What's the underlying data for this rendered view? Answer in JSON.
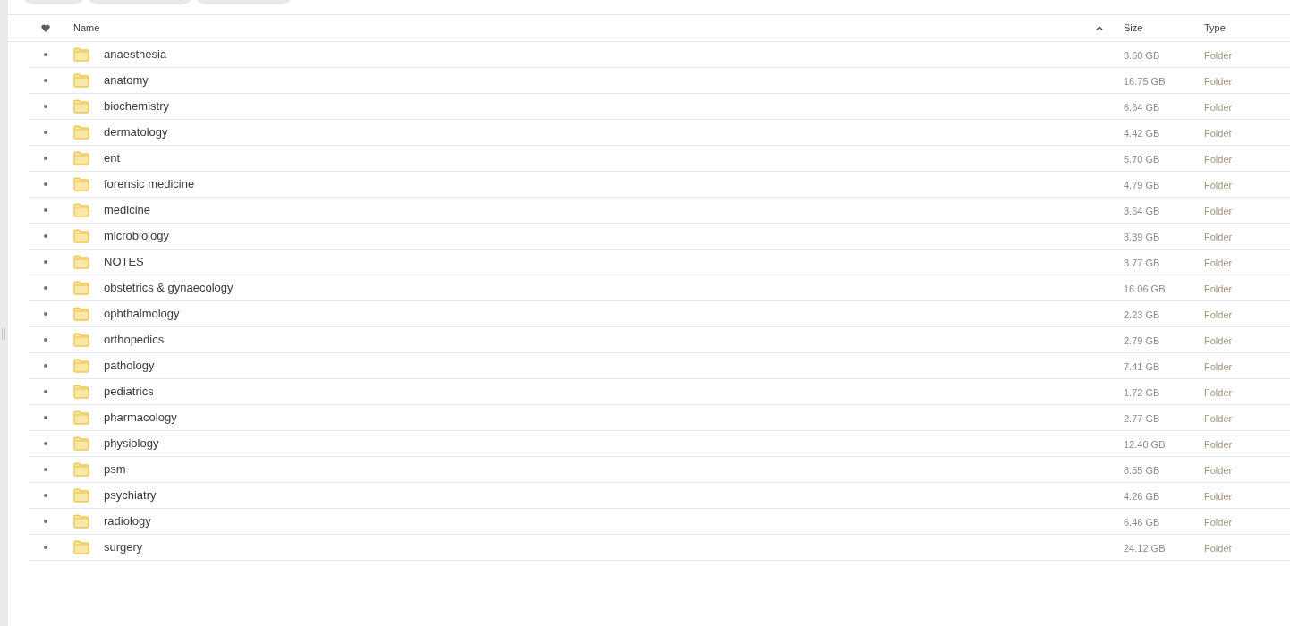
{
  "columns": [
    {
      "kind": "icon"
    },
    {
      "kind": "text",
      "label": "Name",
      "sorted": true
    },
    {
      "kind": "text",
      "label": "Size",
      "sorted": false
    },
    {
      "kind": "text",
      "label": "Type",
      "sorted": false
    }
  ],
  "rows": [
    {
      "name": "anaesthesia",
      "size": "3.60 GB",
      "type": "Folder"
    },
    {
      "name": "anatomy",
      "size": "16.75 GB",
      "type": "Folder"
    },
    {
      "name": "biochemistry",
      "size": "6.64 GB",
      "type": "Folder"
    },
    {
      "name": "dermatology",
      "size": "4.42 GB",
      "type": "Folder"
    },
    {
      "name": "ent",
      "size": "5.70 GB",
      "type": "Folder"
    },
    {
      "name": "forensic medicine",
      "size": "4.79 GB",
      "type": "Folder"
    },
    {
      "name": "medicine",
      "size": "3.64 GB",
      "type": "Folder"
    },
    {
      "name": "microbiology",
      "size": "8.39 GB",
      "type": "Folder"
    },
    {
      "name": "NOTES",
      "size": "3.77 GB",
      "type": "Folder"
    },
    {
      "name": "obstetrics & gynaecology",
      "size": "16.06 GB",
      "type": "Folder"
    },
    {
      "name": "ophthalmology",
      "size": "2.23 GB",
      "type": "Folder"
    },
    {
      "name": "orthopedics",
      "size": "2.79 GB",
      "type": "Folder"
    },
    {
      "name": "pathology",
      "size": "7.41 GB",
      "type": "Folder"
    },
    {
      "name": "pediatrics",
      "size": "1.72 GB",
      "type": "Folder"
    },
    {
      "name": "pharmacology",
      "size": "2.77 GB",
      "type": "Folder"
    },
    {
      "name": "physiology",
      "size": "12.40 GB",
      "type": "Folder"
    },
    {
      "name": "psm",
      "size": "8.55 GB",
      "type": "Folder"
    },
    {
      "name": "psychiatry",
      "size": "4.26 GB",
      "type": "Folder"
    },
    {
      "name": "radiology",
      "size": "6.46 GB",
      "type": "Folder"
    },
    {
      "name": "surgery",
      "size": "24.12 GB",
      "type": "Folder"
    }
  ]
}
